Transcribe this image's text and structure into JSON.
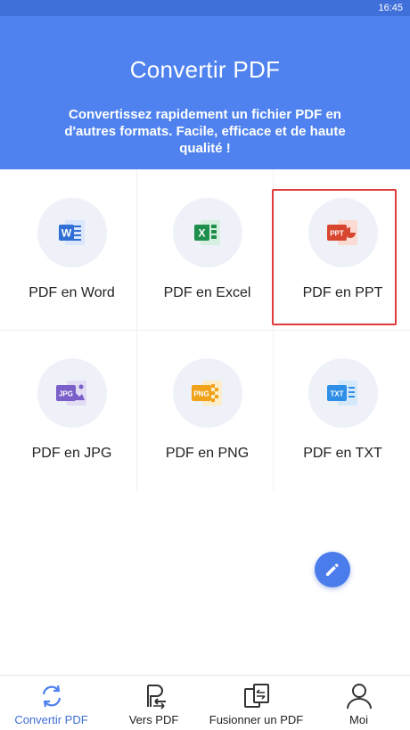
{
  "status_bar": {
    "time": "16:45"
  },
  "header": {
    "title": "Convertir PDF",
    "subtitle": "Convertissez rapidement un fichier PDF en d'autres formats. Facile, efficace et de haute qualité !"
  },
  "tools": [
    {
      "label": "PDF en Word",
      "icon": "word-icon",
      "badge": "W",
      "color": "#2f6fd6"
    },
    {
      "label": "PDF en Excel",
      "icon": "excel-icon",
      "badge": "X",
      "color": "#1f8f4e"
    },
    {
      "label": "PDF en PPT",
      "icon": "ppt-icon",
      "badge": "PPT",
      "color": "#d9462f"
    },
    {
      "label": "PDF en JPG",
      "icon": "jpg-icon",
      "badge": "JPG",
      "color": "#7a5fc8"
    },
    {
      "label": "PDF en PNG",
      "icon": "png-icon",
      "badge": "PNG",
      "color": "#f0a21a"
    },
    {
      "label": "PDF en TXT",
      "icon": "txt-icon",
      "badge": "TXT",
      "color": "#2f8fe6"
    }
  ],
  "fab": {
    "icon": "pencil-icon"
  },
  "bottom_nav": [
    {
      "label": "Convertir PDF",
      "icon": "convert-icon"
    },
    {
      "label": "Vers PDF",
      "icon": "to-pdf-icon"
    },
    {
      "label": "Fusionner un PDF",
      "icon": "merge-icon"
    },
    {
      "label": "Moi",
      "icon": "profile-icon"
    }
  ],
  "colors": {
    "header_bg": "#4f82ee",
    "status_bg": "#3f6fd8",
    "accent": "#3f6fd8",
    "highlight": "#e03a3a"
  }
}
